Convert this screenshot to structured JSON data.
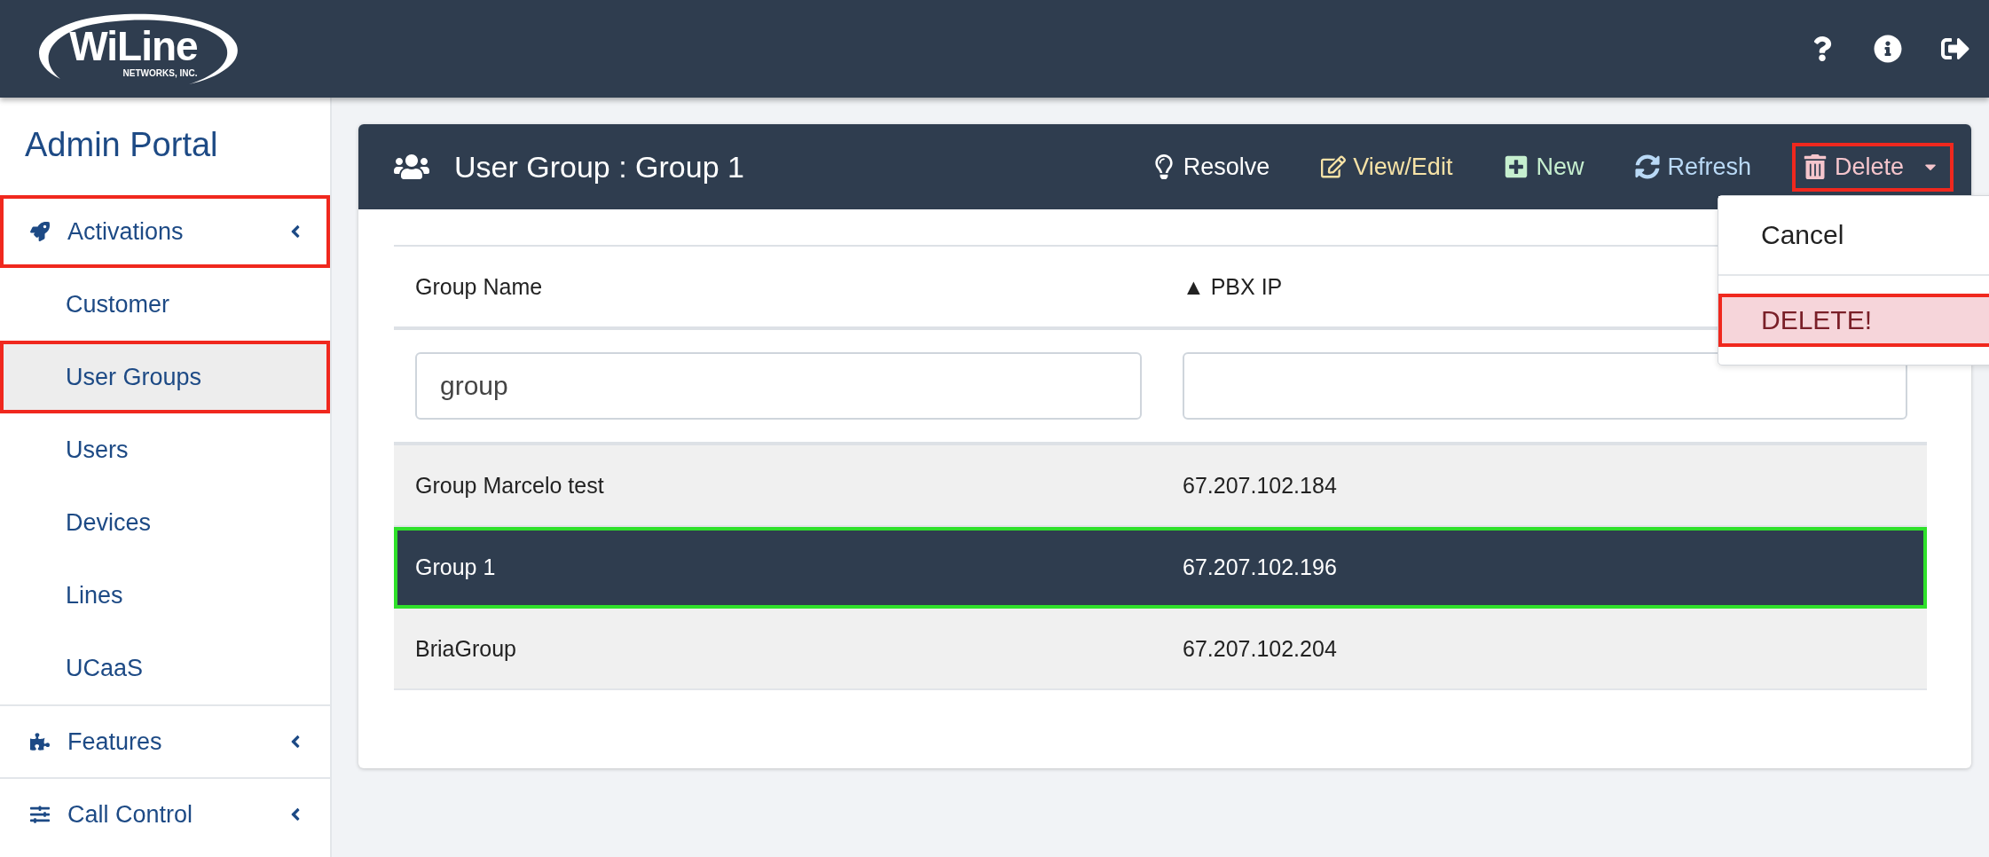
{
  "header": {
    "logo": {
      "name": "WiLine",
      "tagline": "NETWORKS, INC."
    },
    "actions": [
      {
        "kind": "help"
      },
      {
        "kind": "info"
      },
      {
        "kind": "logout"
      }
    ]
  },
  "sidebar": {
    "title": "Admin Portal",
    "sections": [
      {
        "label": "Activations",
        "highlighted": true,
        "children": [
          {
            "label": "Customer",
            "selected": false,
            "highlighted": false
          },
          {
            "label": "User Groups",
            "selected": true,
            "highlighted": true
          },
          {
            "label": "Users",
            "selected": false,
            "highlighted": false
          },
          {
            "label": "Devices",
            "selected": false,
            "highlighted": false
          },
          {
            "label": "Lines",
            "selected": false,
            "highlighted": false
          },
          {
            "label": "UCaaS",
            "selected": false,
            "highlighted": false
          }
        ]
      },
      {
        "label": "Features",
        "highlighted": false
      },
      {
        "label": "Call Control",
        "highlighted": false
      }
    ]
  },
  "panel": {
    "title": "User Group : Group 1",
    "toolbar": [
      {
        "kind": "resolve",
        "label": "Resolve"
      },
      {
        "kind": "edit",
        "label": "View/Edit"
      },
      {
        "kind": "new",
        "label": "New"
      },
      {
        "kind": "refresh",
        "label": "Refresh"
      },
      {
        "kind": "delete",
        "label": "Delete",
        "highlighted": true,
        "expanded": true
      }
    ],
    "menu": [
      {
        "kind": "normal",
        "label": "Cancel",
        "highlighted": false
      },
      {
        "kind": "danger",
        "label": "DELETE!",
        "highlighted": true
      }
    ],
    "table": {
      "columns": [
        "Group Name",
        "▲ PBX IP"
      ],
      "filters": [
        {
          "value": "group"
        }
      ],
      "rows": [
        {
          "cells": [
            "Group Marcelo test",
            "67.207.102.184"
          ],
          "selected": false
        },
        {
          "cells": [
            "Group 1",
            "67.207.102.196"
          ],
          "selected": true
        },
        {
          "cells": [
            "BriaGroup",
            "67.207.102.204"
          ],
          "selected": false
        }
      ]
    }
  }
}
